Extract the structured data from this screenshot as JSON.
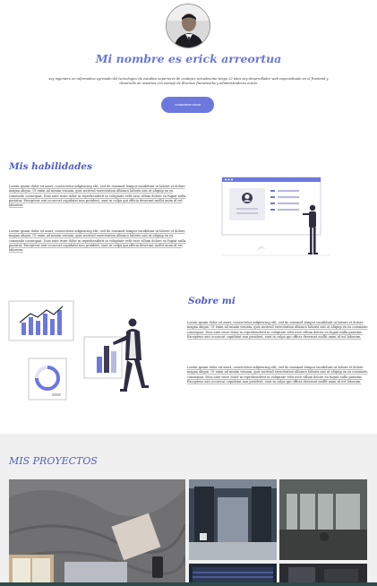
{
  "hero": {
    "title": "Mi nombre es erick arreortua",
    "description": "soy ingeniero en informatica egresado del tecnologico de estudios superiores de ecatepec actualmente tengo 22 años soy desarrollador web especializado en el frontend y desarrollo de usuarios con manejo de diversos frameworks y administradores oracle",
    "button_label": "contactame ahora"
  },
  "skills": {
    "title": "Mis habilidades",
    "paragraphs": [
      "Lorem ipsum dolor sit amet, consectetur adipisicing elit, sed do eiusmod tempor incididunt ut labore et dolore magna aliqua. Ut enim ad minim veniam, quis nostrud exercitation ullamco laboris nisi ut aliquip ex ea commodo consequat. Duis aute irure dolor in reprehenderit in voluptate velit esse cillum dolore eu fugiat nulla pariatur. Excepteur sint occaecat cupidatat non proident, sunt in culpa qui officia deserunt mollit anim id est laborum.",
      "Lorem ipsum dolor sit amet, consectetur adipisicing elit, sed do eiusmod tempor incididunt ut labore et dolore magna aliqua. Ut enim ad minim veniam, quis nostrud exercitation ullamco laboris nisi ut aliquip ex ea commodo consequat. Duis aute irure dolor in reprehenderit in voluptate velit esse cillum dolore eu fugiat nulla pariatur. Excepteur sint occaecat cupidatat non proident, sunt in culpa qui officia deserunt mollit anim id est laborum."
    ]
  },
  "about": {
    "title": "Sobre mi",
    "paragraphs": [
      "Lorem ipsum dolor sit amet, consectetur adipisicing elit, sed do eiusmod tempor incididunt ut labore et dolore magna aliqua. Ut enim ad minim veniam, quis nostrud exercitation ullamco laboris nisi ut aliquip ex ea commodo consequat. Duis aute irure dolor in reprehenderit in voluptate velit esse cillum dolore eu fugiat nulla pariatur. Excepteur sint occaecat cupidatat non proident, sunt in culpa qui officia deserunt mollit anim id est laborum.",
      "Lorem ipsum dolor sit amet, consectetur adipisicing elit, sed do eiusmod tempor incididunt ut labore et dolore magna aliqua. Ut enim ad minim veniam, quis nostrud exercitation ullamco laboris nisi ut aliquip ex ea commodo consequat. Duis aute irure dolor in reprehenderit in voluptate velit esse cillum dolore eu fugiat nulla pariatur. Excepteur sint occaecat cupidatat non proident, sunt in culpa qui officia deserunt mollit anim id est laborum."
    ]
  },
  "projects": {
    "title": "MIS PROYECTOS"
  },
  "colors": {
    "accent": "#6c78dd",
    "heading": "#4f5fc4",
    "projects_bg": "#f0f0f0"
  },
  "icons": [
    "profile-photo",
    "presentation-illustration",
    "analytics-illustration"
  ]
}
